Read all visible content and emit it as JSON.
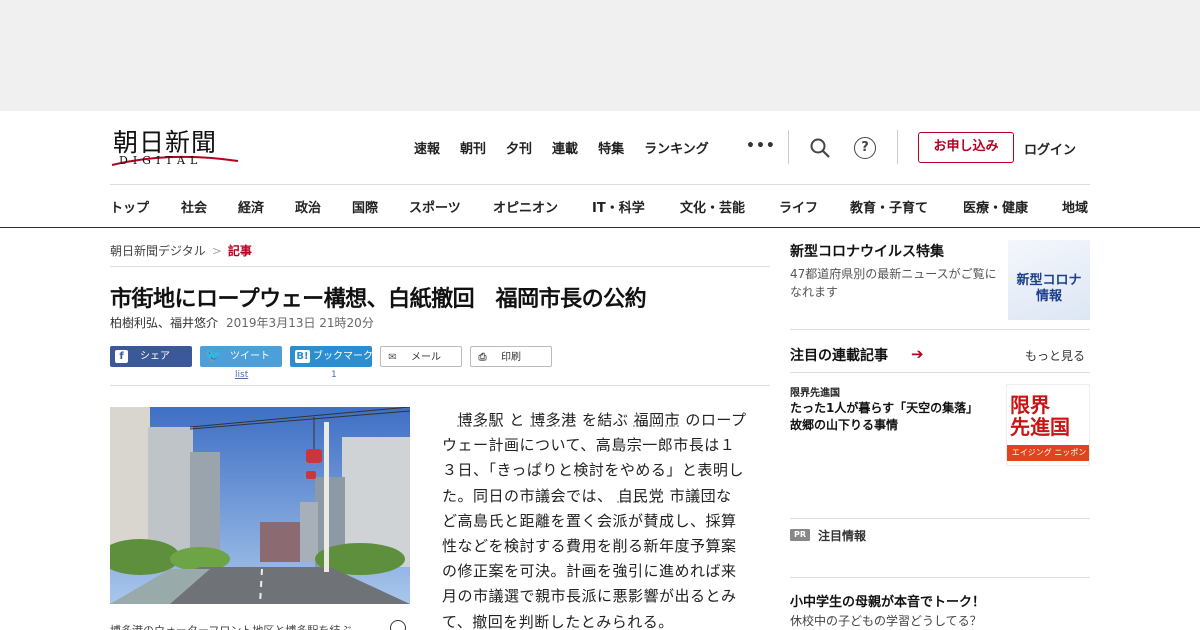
{
  "logo": {
    "main": "朝日新聞",
    "sub": "DIGITAL"
  },
  "topnav": [
    "速報",
    "朝刊",
    "夕刊",
    "連載",
    "特集",
    "ランキング"
  ],
  "more_menu": "•••",
  "apply_label": "お申し込み",
  "login_label": "ログイン",
  "category_nav": [
    "トップ",
    "社会",
    "経済",
    "政治",
    "国際",
    "スポーツ",
    "オピニオン",
    "IT・科学",
    "文化・芸能",
    "ライフ",
    "教育・子育て",
    "医療・健康",
    "地域"
  ],
  "breadcrumb": {
    "home": "朝日新聞デジタル",
    "separator": ">",
    "current": "記事"
  },
  "article": {
    "title": "市街地にロープウェー構想、白紙撤回　福岡市長の公約",
    "authors": "柏樹利弘、福井悠介",
    "date": "2019年3月13日 21時20分",
    "caption": "博多港のウォーターフロント地区と博多駅を結ぶ",
    "body": {
      "kw1": "博多駅",
      "t1": " と ",
      "kw2": "博多港",
      "t2": " を結ぶ ",
      "kw3": "福岡市",
      "t3": " のロープウェー計画について、高島宗一郎市長は１３日、「きっぱりと検討をやめる」と表明した。同日の市議会では、 ",
      "kw4": "自民党",
      "t4": " 市議団など高島氏と距離を置く会派が賛成し、採算性などを検討する費用を削る新年度予算案の修正案を可決。計画を強引に進めれば来月の市議選で親市長派に悪影響が出るとみて、撤回を判断したとみられる。"
    }
  },
  "share": {
    "facebook": "シェア",
    "twitter": "ツイート",
    "twitter_count": "list",
    "hatena": "ブックマーク",
    "hatena_icon": "B!",
    "hatena_count": "1",
    "mail": "メール",
    "print": "印刷"
  },
  "sidebar": {
    "corona": {
      "title": "新型コロナウイルス特集",
      "desc": "47都道府県別の最新ニュースがご覧になれます",
      "img_line1": "新型コロナ",
      "img_line2": "情報"
    },
    "rensai": {
      "title": "注目の連載記事",
      "arrow": "➔",
      "more": "もっと見る",
      "series": "限界先進国",
      "headline": "たった1人が暮らす「天空の集落」　故郷の山下りる事情",
      "img_line1": "限界",
      "img_line2": "先進国",
      "img_band": "エイジング ニッポン"
    },
    "pr": {
      "badge": "PR",
      "label": "注目情報",
      "headline": "小中学生の母親が本音でトーク！",
      "sub": "休校中の子どもの学習どうしてる？"
    }
  },
  "colors": {
    "brand_red": "#b5001f",
    "facebook": "#3b5998",
    "twitter": "#4d9fd9",
    "hatena": "#2b8ed1"
  }
}
